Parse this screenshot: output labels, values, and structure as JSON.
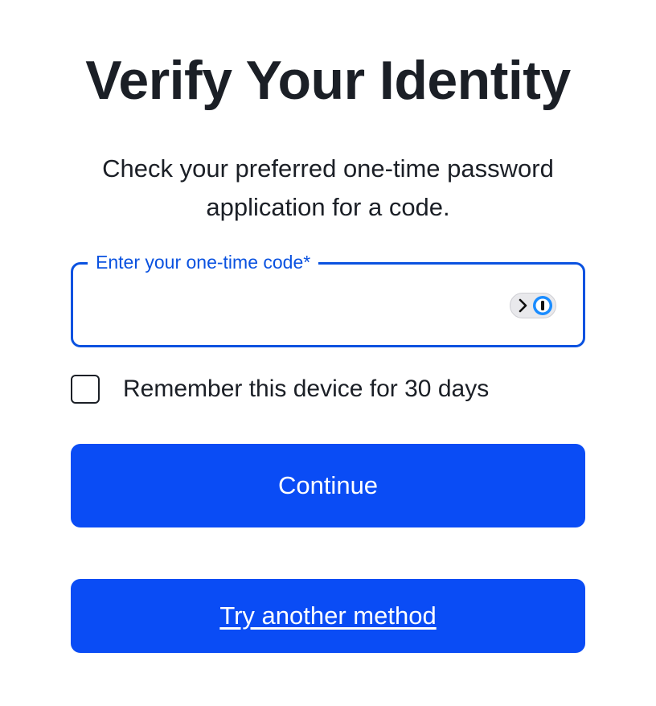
{
  "page": {
    "title": "Verify Your Identity",
    "subtitle": "Check your preferred one-time password application for a code."
  },
  "otp_field": {
    "label": "Enter your one-time code*",
    "value": "",
    "accent_color": "#0a52e0",
    "password_manager_icon": "1password-logo-icon"
  },
  "remember_device": {
    "label": "Remember this device for 30 days",
    "checked": false
  },
  "buttons": {
    "continue_label": "Continue",
    "other_method_label": "Try another method",
    "color": "#0a4cf5"
  }
}
